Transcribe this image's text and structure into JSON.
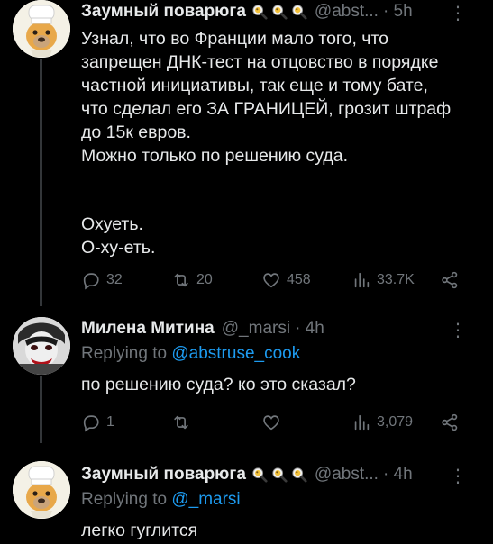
{
  "tweets": [
    {
      "author": "Заумный поварюга",
      "handle": "@abst...",
      "time": "· 5h",
      "more": "⋮",
      "lines": [
        "Узнал, что во Франции мало того, что",
        "запрещен ДНК-тест на отцовство в порядке",
        "частной инициативы, так еще и тому бате,",
        "что сделал его ЗА ГРАНИЦЕЙ, грозит штраф",
        "до 15к евров.",
        "Можно только по решению суда.",
        "",
        "Охуеть.",
        "О-ху-еть."
      ],
      "actions": {
        "replies": "32",
        "retweets": "20",
        "likes": "458",
        "views": "33.7K"
      }
    },
    {
      "author": "Милена Митина",
      "handle": "@_marsi",
      "time": "· 4h",
      "more": "⋮",
      "replying_label": "Replying to",
      "replying_handle": "@abstruse_cook",
      "lines": [
        "по решению суда? ко это сказал?"
      ],
      "actions": {
        "replies": "1",
        "retweets": "",
        "likes": "",
        "views": "3,079"
      }
    },
    {
      "author": "Заумный поварюга",
      "handle": "@abst...",
      "time": "· 4h",
      "more": "⋮",
      "replying_label": "Replying to",
      "replying_handle": "@_marsi",
      "lines": [
        "легко гуглится"
      ]
    }
  ],
  "icons": [
    "reply-icon",
    "retweet-icon",
    "like-icon",
    "views-icon",
    "share-icon",
    "magnifier-badge-icon",
    "more-icon"
  ],
  "colors": {
    "background": "#000000",
    "text": "#e7e9ea",
    "muted": "#71767b",
    "link": "#1d9bf0",
    "thread_line": "#333639"
  }
}
